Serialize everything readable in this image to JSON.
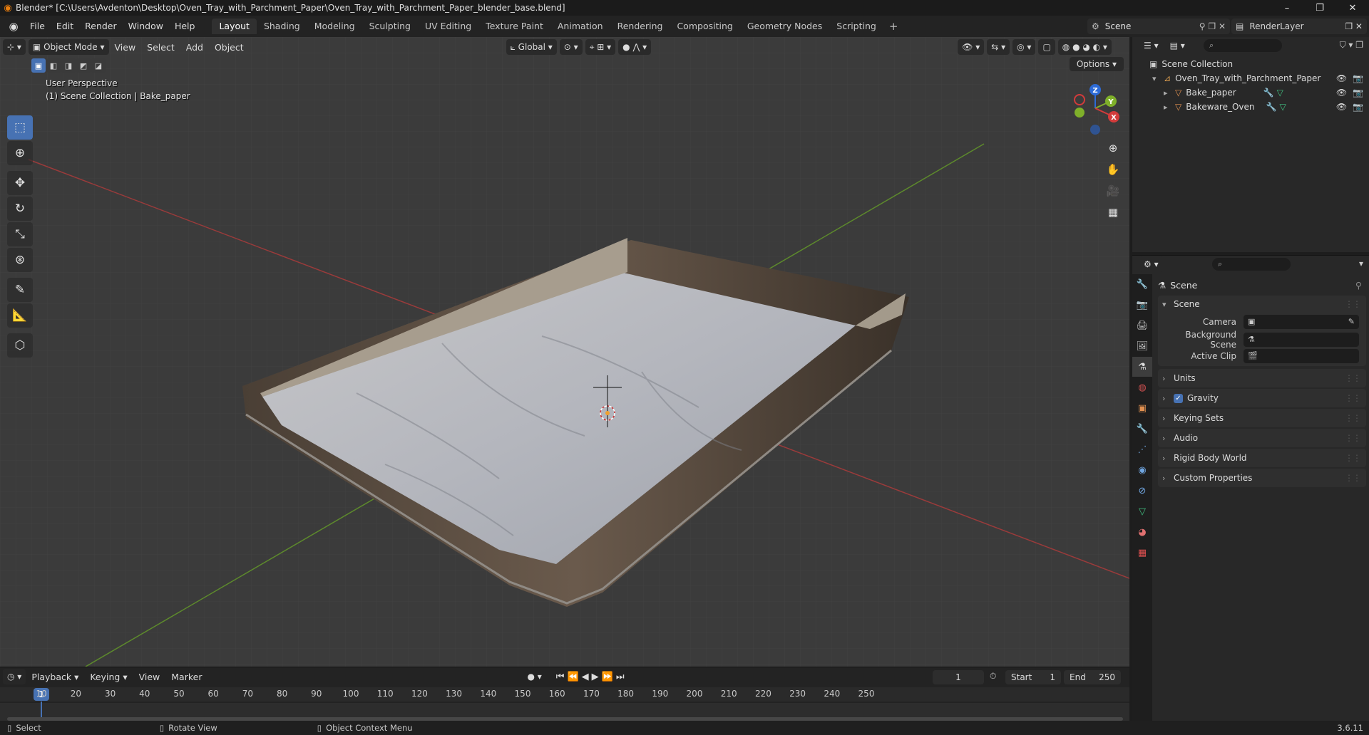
{
  "window": {
    "title": "Blender* [C:\\Users\\Avdenton\\Desktop\\Oven_Tray_with_Parchment_Paper\\Oven_Tray_with_Parchment_Paper_blender_base.blend]",
    "minimize": "–",
    "maximize": "❐",
    "close": "✕"
  },
  "menubar": {
    "items": [
      "File",
      "Edit",
      "Render",
      "Window",
      "Help"
    ],
    "workspaces": [
      "Layout",
      "Shading",
      "Modeling",
      "Sculpting",
      "UV Editing",
      "Texture Paint",
      "Animation",
      "Rendering",
      "Compositing",
      "Geometry Nodes",
      "Scripting"
    ],
    "add_tab": "+",
    "scene": "Scene",
    "render_layer": "RenderLayer"
  },
  "viewport": {
    "mode": "Object Mode",
    "menus": [
      "View",
      "Select",
      "Add",
      "Object"
    ],
    "transform_orientation": "Global",
    "perspective_label": "User Perspective",
    "collection_label": "(1) Scene Collection | Bake_paper",
    "options_label": "Options",
    "gizmo_axes": {
      "x": "X",
      "y": "Y",
      "z": "Z"
    }
  },
  "timeline": {
    "menus": [
      "Playback",
      "Keying",
      "View",
      "Marker"
    ],
    "current_frame": "1",
    "start_label": "Start",
    "start_value": "1",
    "end_label": "End",
    "end_value": "250",
    "ruler_current": "1",
    "ticks": [
      "10",
      "20",
      "30",
      "40",
      "50",
      "60",
      "70",
      "80",
      "90",
      "100",
      "110",
      "120",
      "130",
      "140",
      "150",
      "160",
      "170",
      "180",
      "190",
      "200",
      "210",
      "220",
      "230",
      "240",
      "250"
    ]
  },
  "statusbar": {
    "select": "Select",
    "rotate": "Rotate View",
    "context_menu": "Object Context Menu",
    "version": "3.6.11"
  },
  "outliner": {
    "root": "Scene Collection",
    "collection": "Oven_Tray_with_Parchment_Paper",
    "objects": [
      "Bake_paper",
      "Bakeware_Oven"
    ]
  },
  "properties": {
    "context_title": "Scene",
    "scene_panel": "Scene",
    "camera_label": "Camera",
    "background_label": "Background Scene",
    "clip_label": "Active Clip",
    "subpanels": [
      "Units",
      "Gravity",
      "Keying Sets",
      "Audio",
      "Rigid Body World",
      "Custom Properties"
    ]
  }
}
